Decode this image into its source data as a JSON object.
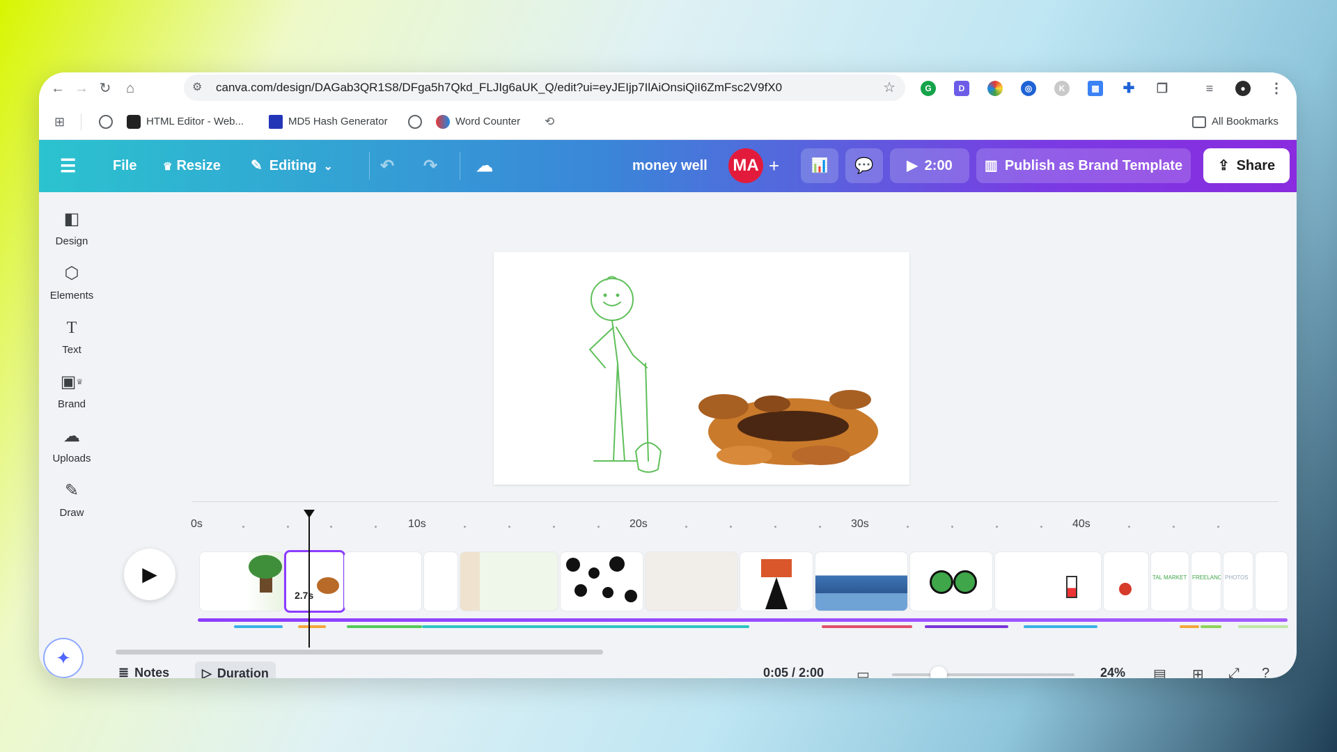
{
  "browser": {
    "url": "canva.com/design/DAGab3QR1S8/DFga5h7Qkd_FLJIg6aUK_Q/edit?ui=eyJEIjp7IlAiOnsiQiI6ZmFsc2V9fX0",
    "bookmarks": [
      {
        "label": "HTML Editor - Web..."
      },
      {
        "label": "MD5 Hash Generator"
      },
      {
        "label": "Word Counter"
      }
    ],
    "all_bookmarks_label": "All Bookmarks"
  },
  "header": {
    "file_label": "File",
    "resize_label": "Resize",
    "editing_label": "Editing",
    "design_title": "money well",
    "avatar_initials": "MA",
    "play_duration": "2:00",
    "publish_label": "Publish as Brand Template",
    "share_label": "Share"
  },
  "sidebar": {
    "items": [
      {
        "label": "Design"
      },
      {
        "label": "Elements"
      },
      {
        "label": "Text"
      },
      {
        "label": "Brand"
      },
      {
        "label": "Uploads"
      },
      {
        "label": "Draw"
      }
    ]
  },
  "timeline": {
    "ticks": [
      "0s",
      "10s",
      "20s",
      "30s",
      "40s"
    ],
    "active_clip_duration": "2.7s",
    "clip_texts": [
      "TAL MARKET",
      "FREELANCE",
      "PHOTOS"
    ]
  },
  "footer": {
    "notes_label": "Notes",
    "duration_label": "Duration",
    "time_display": "0:05 / 2:00",
    "zoom_level": "24%"
  },
  "colors": {
    "header_gradient_start": "#2bc3cf",
    "header_gradient_end": "#8a2bdf",
    "accent": "#8b3dff",
    "avatar": "#e21b3c"
  }
}
